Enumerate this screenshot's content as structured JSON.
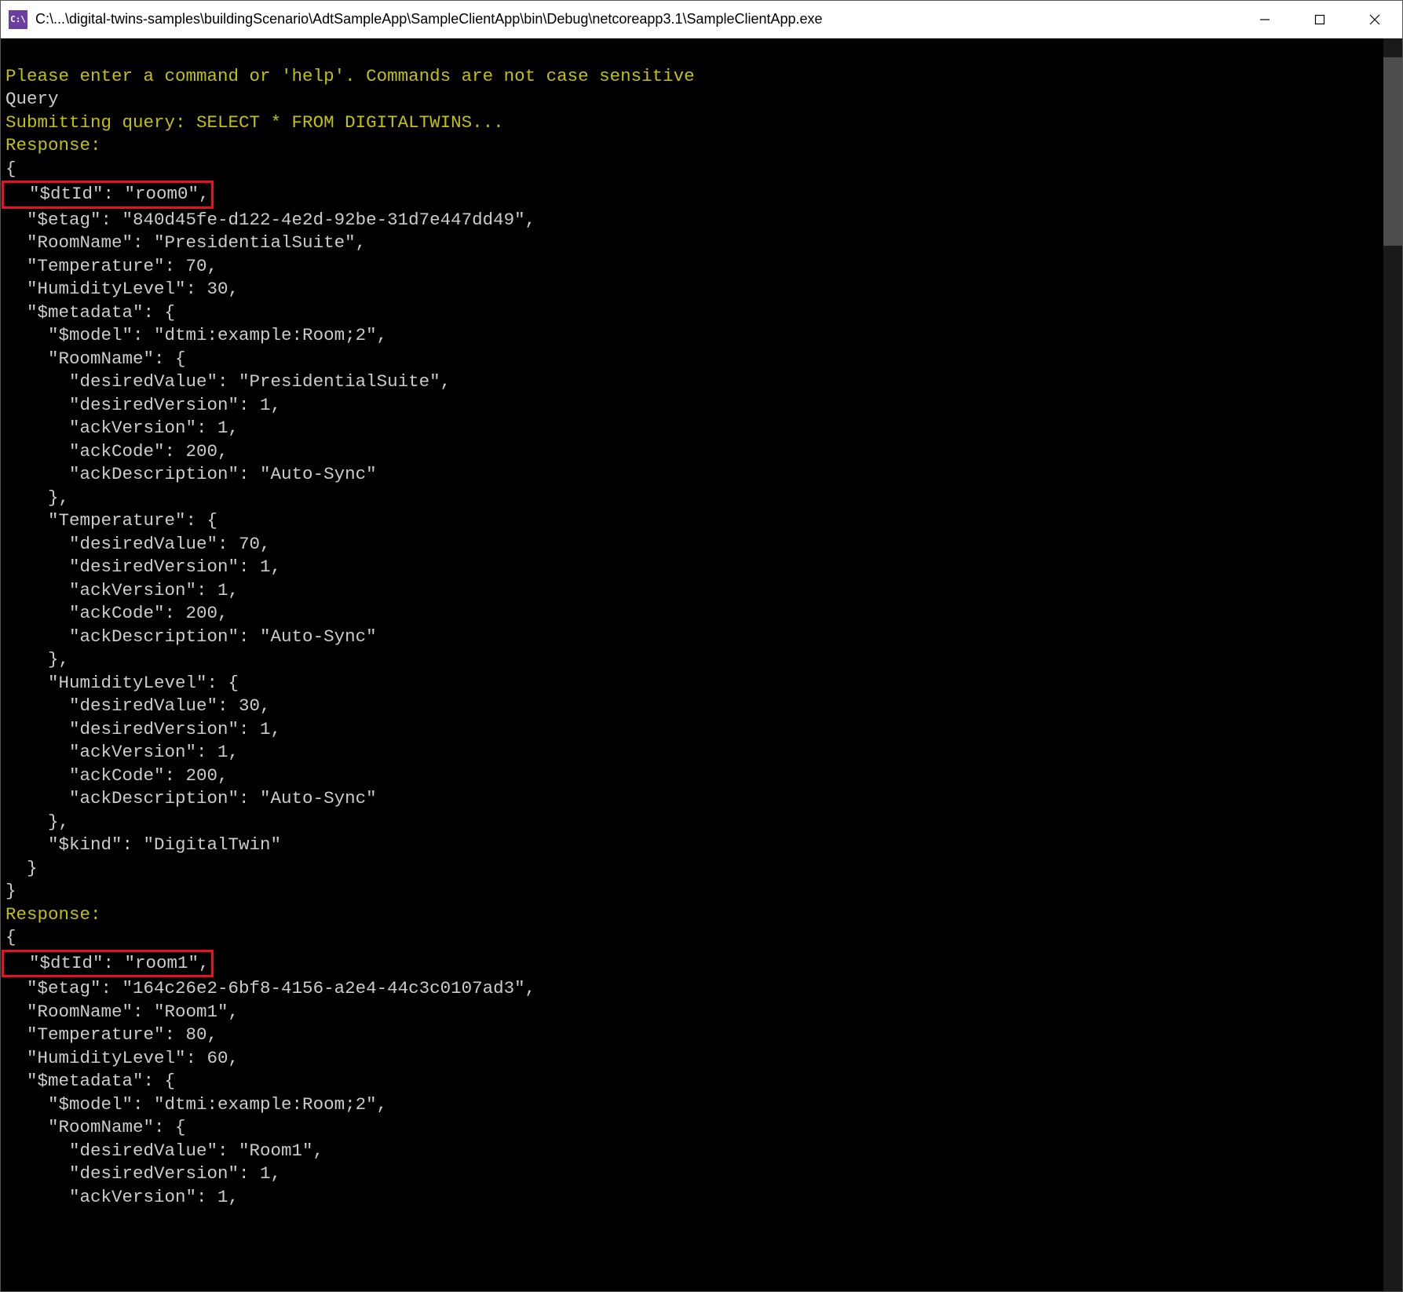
{
  "window": {
    "icon_text": "C:\\",
    "title": "C:\\...\\digital-twins-samples\\buildingScenario\\AdtSampleApp\\SampleClientApp\\bin\\Debug\\netcoreapp3.1\\SampleClientApp.exe"
  },
  "console": {
    "prompt": "Please enter a command or 'help'. Commands are not case sensitive",
    "input": "Query",
    "submitting": "Submitting query: SELECT * FROM DIGITALTWINS...",
    "response_label": "Response:",
    "block1": {
      "open": "{",
      "dtid": "  \"$dtId\": \"room0\",",
      "etag": "  \"$etag\": \"840d45fe-d122-4e2d-92be-31d7e447dd49\",",
      "roomname": "  \"RoomName\": \"PresidentialSuite\",",
      "temp": "  \"Temperature\": 70,",
      "hum": "  \"HumidityLevel\": 30,",
      "meta_open": "  \"$metadata\": {",
      "model": "    \"$model\": \"dtmi:example:Room;2\",",
      "rn_open": "    \"RoomName\": {",
      "rn_dv": "      \"desiredValue\": \"PresidentialSuite\",",
      "rn_dver": "      \"desiredVersion\": 1,",
      "rn_av": "      \"ackVersion\": 1,",
      "rn_ac": "      \"ackCode\": 200,",
      "rn_ad": "      \"ackDescription\": \"Auto-Sync\"",
      "rn_close": "    },",
      "t_open": "    \"Temperature\": {",
      "t_dv": "      \"desiredValue\": 70,",
      "t_dver": "      \"desiredVersion\": 1,",
      "t_av": "      \"ackVersion\": 1,",
      "t_ac": "      \"ackCode\": 200,",
      "t_ad": "      \"ackDescription\": \"Auto-Sync\"",
      "t_close": "    },",
      "h_open": "    \"HumidityLevel\": {",
      "h_dv": "      \"desiredValue\": 30,",
      "h_dver": "      \"desiredVersion\": 1,",
      "h_av": "      \"ackVersion\": 1,",
      "h_ac": "      \"ackCode\": 200,",
      "h_ad": "      \"ackDescription\": \"Auto-Sync\"",
      "h_close": "    },",
      "kind": "    \"$kind\": \"DigitalTwin\"",
      "meta_close": "  }",
      "close": "}"
    },
    "block2": {
      "open": "{",
      "dtid": "  \"$dtId\": \"room1\",",
      "etag": "  \"$etag\": \"164c26e2-6bf8-4156-a2e4-44c3c0107ad3\",",
      "roomname": "  \"RoomName\": \"Room1\",",
      "temp": "  \"Temperature\": 80,",
      "hum": "  \"HumidityLevel\": 60,",
      "meta_open": "  \"$metadata\": {",
      "model": "    \"$model\": \"dtmi:example:Room;2\",",
      "rn_open": "    \"RoomName\": {",
      "rn_dv": "      \"desiredValue\": \"Room1\",",
      "rn_dver": "      \"desiredVersion\": 1,",
      "rn_av": "      \"ackVersion\": 1,"
    }
  }
}
